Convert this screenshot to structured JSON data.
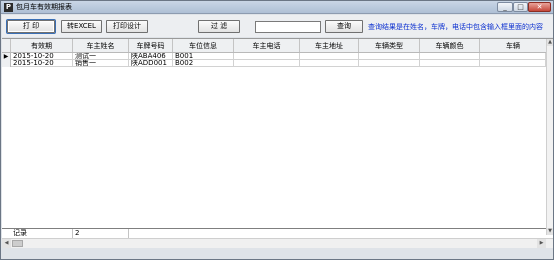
{
  "window": {
    "title": "包月车有效期报表",
    "icon_letter": "P",
    "minimize": "_",
    "maximize": "□",
    "close": "✕"
  },
  "toolbar": {
    "print_label": "打 印",
    "excel_label": "转EXCEL",
    "print_design_label": "打印设计",
    "filter_label": "过 滤",
    "filter_value": "",
    "query_label": "查询",
    "hint": "查询结果是在姓名，车牌，电话中包含输入框里面的内容"
  },
  "table": {
    "columns": [
      "有效期",
      "车主姓名",
      "车牌号码",
      "车位信息",
      "车主电话",
      "车主地址",
      "车辆类型",
      "车辆颜色",
      "车辆"
    ],
    "rows": [
      [
        "2015-10-20",
        "测试一",
        "陕ABA406",
        "B001",
        "",
        "",
        "",
        "",
        ""
      ],
      [
        "2015-10-20",
        "销售一",
        "陕ADD001",
        "B002",
        "",
        "",
        "",
        "",
        ""
      ]
    ],
    "current_row_marker": "▶"
  },
  "footer": {
    "label": "记录",
    "count": "2"
  },
  "scroll": {
    "up": "▲",
    "down": "▼",
    "left": "◀",
    "right": "▶"
  }
}
